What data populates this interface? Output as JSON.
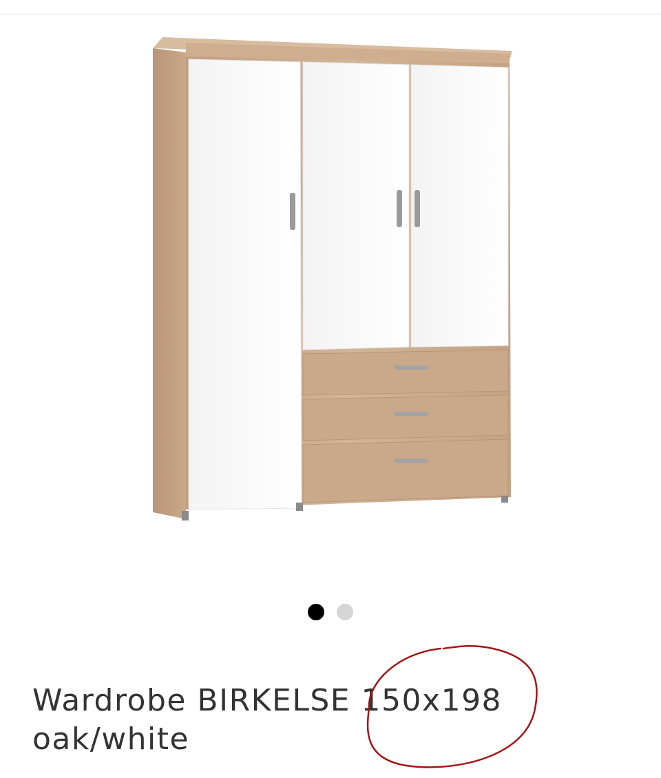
{
  "carousel": {
    "total_slides": 2,
    "active_slide": 1
  },
  "product": {
    "title_line1": "Wardrobe BIRKELSE 150x198",
    "title_line2": "oak/white",
    "image_icon": "wardrobe-product-image"
  },
  "annotation": {
    "color": "#a31515",
    "note": "hand-drawn circle around dimensions"
  },
  "colors": {
    "oak": "#c9a98a",
    "door_white": "#ffffff",
    "dot_active": "#000000",
    "dot_inactive": "#d6d6d6"
  }
}
